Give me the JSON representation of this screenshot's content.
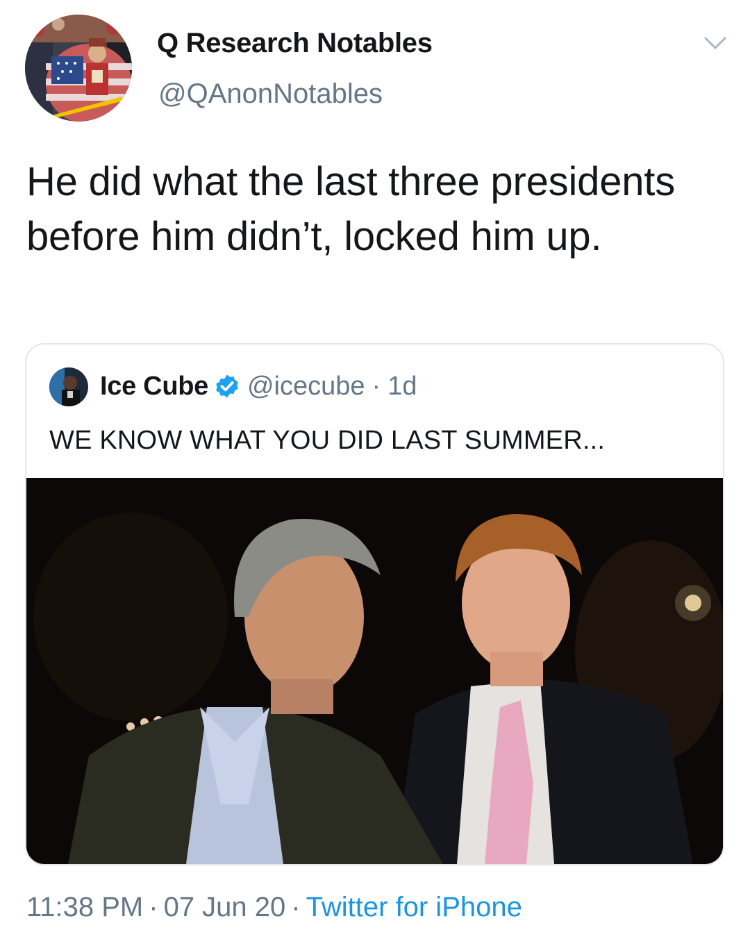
{
  "author": {
    "display_name": "Q Research Notables",
    "handle": "@QAnonNotables"
  },
  "tweet": {
    "text": "He did what the last three presidents before him didn’t, locked him up."
  },
  "quoted_tweet": {
    "display_name": "Ice Cube",
    "handle": "@icecube",
    "separator": "·",
    "time_ago": "1d",
    "text": "WE KNOW WHAT YOU DID LAST SUMMER..."
  },
  "meta": {
    "time": "11:38 PM",
    "separator": "·",
    "date": "07 Jun 20",
    "source": "Twitter for iPhone"
  },
  "icons": {
    "menu": "chevron-down-icon",
    "verified": "verified-badge-icon"
  },
  "colors": {
    "text": "#14171a",
    "secondary_text": "#657786",
    "link": "#1b95e0",
    "verified": "#1da1f2",
    "card_border": "#e1e8ed"
  }
}
